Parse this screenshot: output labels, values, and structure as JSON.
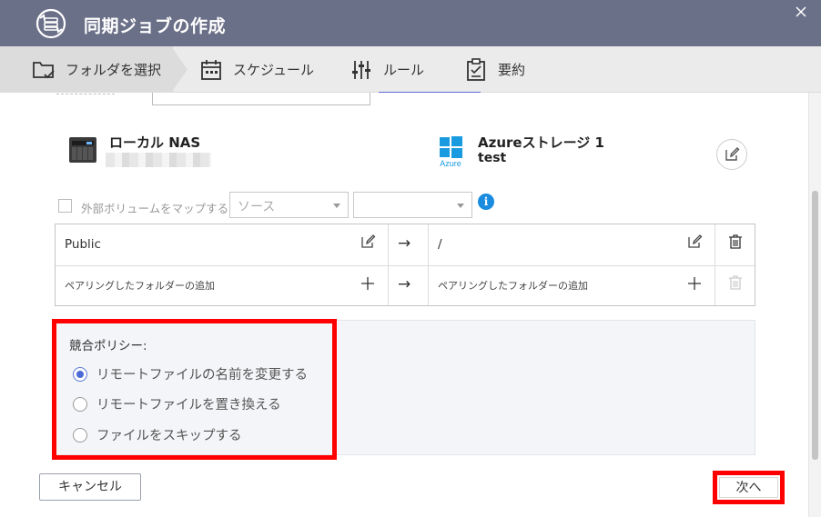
{
  "dialog": {
    "title": "同期ジョブの作成",
    "close_icon": "close-icon"
  },
  "steps": [
    {
      "label": "フォルダを選択",
      "icon": "folder-check-icon",
      "active": true
    },
    {
      "label": "スケジュール",
      "icon": "calendar-icon",
      "active": false
    },
    {
      "label": "ルール",
      "icon": "sliders-icon",
      "active": false
    },
    {
      "label": "要約",
      "icon": "clipboard-icon",
      "active": false
    }
  ],
  "source": {
    "title": "ローカル NAS",
    "icon": "nas-icon"
  },
  "destination": {
    "title": "Azureストレージ 1",
    "subtitle": "test",
    "icon_text": "Azure",
    "icon": "azure-windows-icon",
    "edit_icon": "edit-icon"
  },
  "map_volume": {
    "label": "外部ボリュームをマップする",
    "source_select": "ソース",
    "target_select": "",
    "checked": false,
    "info": "i"
  },
  "pairs": [
    {
      "local": "Public",
      "arrow": "→",
      "remote": "/",
      "kind": "existing"
    },
    {
      "local": "ペアリングしたフォルダーの追加",
      "arrow": "→",
      "remote": "ペアリングしたフォルダーの追加",
      "kind": "add"
    }
  ],
  "conflict_policy": {
    "title": "競合ポリシー:",
    "options": [
      {
        "label": "リモートファイルの名前を変更する",
        "selected": true
      },
      {
        "label": "リモートファイルを置き換える",
        "selected": false
      },
      {
        "label": "ファイルをスキップする",
        "selected": false
      }
    ]
  },
  "footer": {
    "cancel_label": "キャンセル",
    "next_label": "次へ"
  },
  "colors": {
    "header_bg": "#6b7089",
    "accent": "#4a6bd6",
    "highlight": "#ff0000",
    "info": "#1a8cdf"
  }
}
